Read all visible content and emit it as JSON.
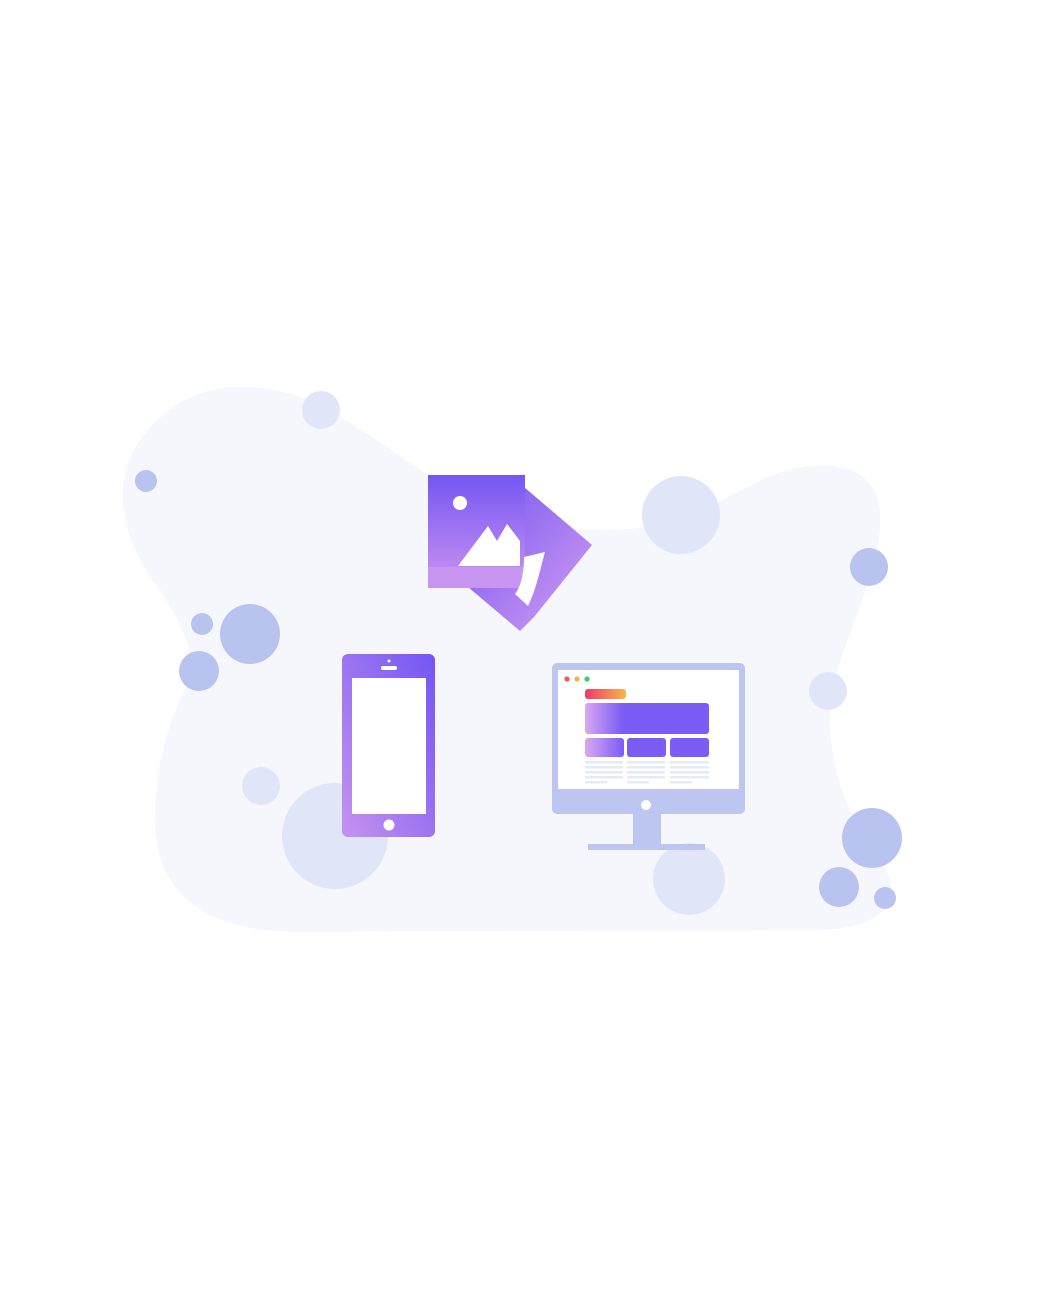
{
  "illustration": {
    "icons": {
      "image_icon": "image-icon",
      "phone_icon": "smartphone-icon",
      "monitor_icon": "desktop-monitor-icon"
    },
    "colors": {
      "blob_background": "#f6f7fc",
      "bubble_light": "#e1e5f8",
      "bubble_medium": "#b9c3f0",
      "purple_primary": "#7b5cf5",
      "purple_light": "#c98ef0",
      "monitor_frame": "#bcc6f0",
      "window_dot_red": "#f25a5a",
      "window_dot_yellow": "#f5b447",
      "window_dot_green": "#3ccb6d",
      "banner_gradient_start": "#f0386b",
      "banner_gradient_end": "#f7b846"
    }
  }
}
